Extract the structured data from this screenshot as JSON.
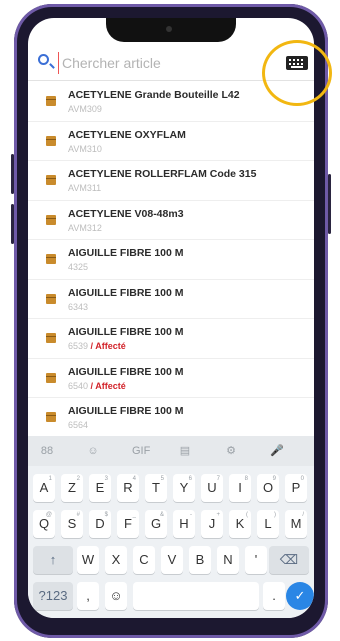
{
  "search": {
    "placeholder": "Chercher article"
  },
  "items": [
    {
      "title": "ACETYLENE Grande Bouteille L42",
      "code": "AVM309",
      "flag": ""
    },
    {
      "title": "ACETYLENE OXYFLAM",
      "code": "AVM310",
      "flag": ""
    },
    {
      "title": "ACETYLENE ROLLERFLAM Code 315",
      "code": "AVM311",
      "flag": ""
    },
    {
      "title": "ACETYLENE V08-48m3",
      "code": "AVM312",
      "flag": ""
    },
    {
      "title": "AIGUILLE FIBRE 100 M",
      "code": "4325",
      "flag": ""
    },
    {
      "title": "AIGUILLE FIBRE 100 M",
      "code": "6343",
      "flag": ""
    },
    {
      "title": "AIGUILLE FIBRE 100 M",
      "code": "6539",
      "flag": "/ Affecté"
    },
    {
      "title": "AIGUILLE FIBRE 100 M",
      "code": "6540",
      "flag": "/ Affecté"
    },
    {
      "title": "AIGUILLE FIBRE 100 M",
      "code": "6564",
      "flag": ""
    }
  ],
  "keyboard": {
    "toolbar": [
      "88",
      "☺",
      "GIF",
      "▤",
      "⚙",
      "🎤"
    ],
    "row1": [
      {
        "k": "A",
        "s": "1"
      },
      {
        "k": "Z",
        "s": "2"
      },
      {
        "k": "E",
        "s": "3"
      },
      {
        "k": "R",
        "s": "4"
      },
      {
        "k": "T",
        "s": "5"
      },
      {
        "k": "Y",
        "s": "6"
      },
      {
        "k": "U",
        "s": "7"
      },
      {
        "k": "I",
        "s": "8"
      },
      {
        "k": "O",
        "s": "9"
      },
      {
        "k": "P",
        "s": "0"
      }
    ],
    "row2": [
      {
        "k": "Q",
        "s": "@"
      },
      {
        "k": "S",
        "s": "#"
      },
      {
        "k": "D",
        "s": "$"
      },
      {
        "k": "F",
        "s": "_"
      },
      {
        "k": "G",
        "s": "&"
      },
      {
        "k": "H",
        "s": "-"
      },
      {
        "k": "J",
        "s": "+"
      },
      {
        "k": "K",
        "s": "("
      },
      {
        "k": "L",
        "s": ")"
      },
      {
        "k": "M",
        "s": "/"
      }
    ],
    "row3": [
      "W",
      "X",
      "C",
      "V",
      "B",
      "N",
      "'"
    ],
    "shift": "↑",
    "backspace": "⌫",
    "symbols": "?123",
    "comma": ",",
    "emoji": "☺",
    "period": ".",
    "enter": "✓"
  },
  "colors": {
    "accent": "#2a86e5",
    "flag": "#d2232a",
    "ring": "#f2b711"
  }
}
